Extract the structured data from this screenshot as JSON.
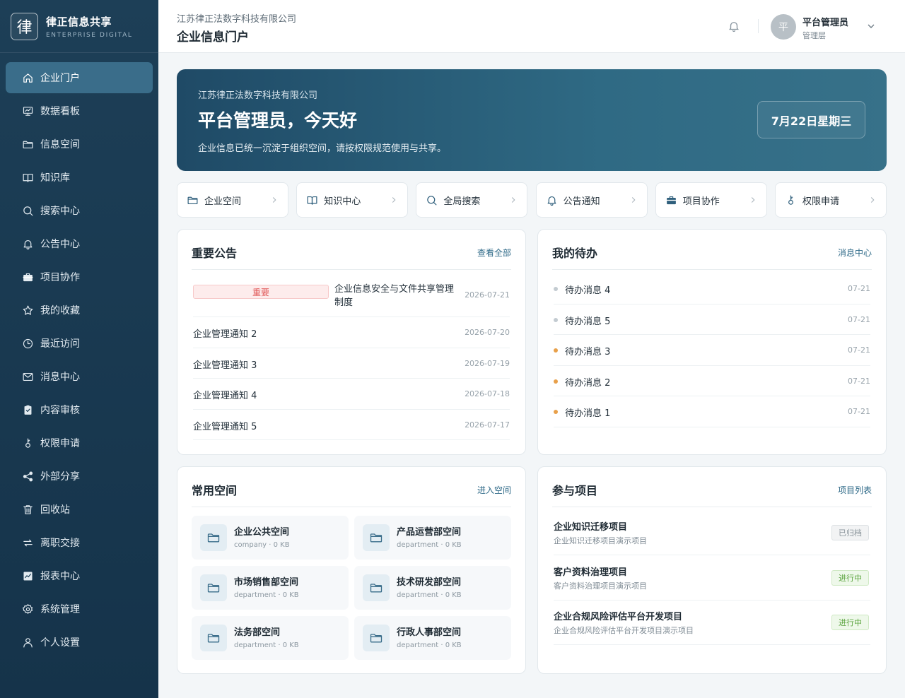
{
  "brand": {
    "logo_char": "律",
    "title": "律正信息共享",
    "subtitle": "ENTERPRISE DIGITAL"
  },
  "sidebar": {
    "items": [
      {
        "label": "企业门户",
        "icon": "home-icon",
        "active": true
      },
      {
        "label": "数据看板",
        "icon": "dashboard-icon"
      },
      {
        "label": "信息空间",
        "icon": "folder-icon"
      },
      {
        "label": "知识库",
        "icon": "book-icon"
      },
      {
        "label": "搜索中心",
        "icon": "search-icon"
      },
      {
        "label": "公告中心",
        "icon": "bell-icon"
      },
      {
        "label": "项目协作",
        "icon": "briefcase-icon"
      },
      {
        "label": "我的收藏",
        "icon": "star-icon"
      },
      {
        "label": "最近访问",
        "icon": "clock-icon"
      },
      {
        "label": "消息中心",
        "icon": "mail-icon"
      },
      {
        "label": "内容审核",
        "icon": "clipboard-check-icon"
      },
      {
        "label": "权限申请",
        "icon": "key-icon"
      },
      {
        "label": "外部分享",
        "icon": "share-icon"
      },
      {
        "label": "回收站",
        "icon": "trash-icon"
      },
      {
        "label": "离职交接",
        "icon": "transfer-icon"
      },
      {
        "label": "报表中心",
        "icon": "chart-icon"
      },
      {
        "label": "系统管理",
        "icon": "gear-icon"
      },
      {
        "label": "个人设置",
        "icon": "user-icon"
      }
    ]
  },
  "header": {
    "company": "江苏律正法数字科技有限公司",
    "title": "企业信息门户",
    "user_avatar_char": "平",
    "user_name": "平台管理员",
    "user_role": "管理层"
  },
  "hero": {
    "company": "江苏律正法数字科技有限公司",
    "greeting": "平台管理员，今天好",
    "description": "企业信息已统一沉淀于组织空间，请按权限规范使用与共享。",
    "date": "7月22日星期三"
  },
  "quick_links": [
    {
      "label": "企业空间",
      "icon": "folder-icon"
    },
    {
      "label": "知识中心",
      "icon": "book-icon"
    },
    {
      "label": "全局搜索",
      "icon": "search-icon"
    },
    {
      "label": "公告通知",
      "icon": "bell-icon"
    },
    {
      "label": "项目协作",
      "icon": "briefcase-icon"
    },
    {
      "label": "权限申请",
      "icon": "key-icon"
    }
  ],
  "announcements": {
    "title": "重要公告",
    "link": "查看全部",
    "important_badge": "重要",
    "important_title_line1": "企业信息安全与文件共享管理",
    "important_title_line2": "制度",
    "important_date": "2026-07-21",
    "items": [
      {
        "title": "企业管理通知 2",
        "date": "2026-07-20"
      },
      {
        "title": "企业管理通知 3",
        "date": "2026-07-19"
      },
      {
        "title": "企业管理通知 4",
        "date": "2026-07-18"
      },
      {
        "title": "企业管理通知 5",
        "date": "2026-07-17"
      }
    ]
  },
  "todos": {
    "title": "我的待办",
    "link": "消息中心",
    "items": [
      {
        "title": "待办消息 4",
        "date": "07-21",
        "status": "read"
      },
      {
        "title": "待办消息 5",
        "date": "07-21",
        "status": "read"
      },
      {
        "title": "待办消息 3",
        "date": "07-21",
        "status": "unread"
      },
      {
        "title": "待办消息 2",
        "date": "07-21",
        "status": "unread"
      },
      {
        "title": "待办消息 1",
        "date": "07-21",
        "status": "unread"
      }
    ]
  },
  "spaces": {
    "title": "常用空间",
    "link": "进入空间",
    "items": [
      {
        "name": "企业公共空间",
        "meta": "company · 0 KB"
      },
      {
        "name": "产品运营部空间",
        "meta": "department · 0 KB"
      },
      {
        "name": "市场销售部空间",
        "meta": "department · 0 KB"
      },
      {
        "name": "技术研发部空间",
        "meta": "department · 0 KB"
      },
      {
        "name": "法务部空间",
        "meta": "department · 0 KB"
      },
      {
        "name": "行政人事部空间",
        "meta": "department · 0 KB"
      }
    ]
  },
  "projects": {
    "title": "参与项目",
    "link": "项目列表",
    "items": [
      {
        "name": "企业知识迁移项目",
        "desc": "企业知识迁移项目演示项目",
        "status": "已归档",
        "state": "archived"
      },
      {
        "name": "客户资料治理项目",
        "desc": "客户资料治理项目演示项目",
        "status": "进行中",
        "state": "active"
      },
      {
        "name": "企业合规风险评估平台开发项目",
        "desc": "企业合规风险评估平台开发项目演示项目",
        "status": "进行中",
        "state": "active"
      }
    ]
  },
  "colors": {
    "sidebar_bg": "#1d3f57",
    "active_nav": "#3a6d8a",
    "accent": "#2f6a88",
    "important": "#e05454",
    "unread_dot": "#e8a04a",
    "read_dot": "#c3cbd1",
    "active_badge": "#5aa33d"
  }
}
